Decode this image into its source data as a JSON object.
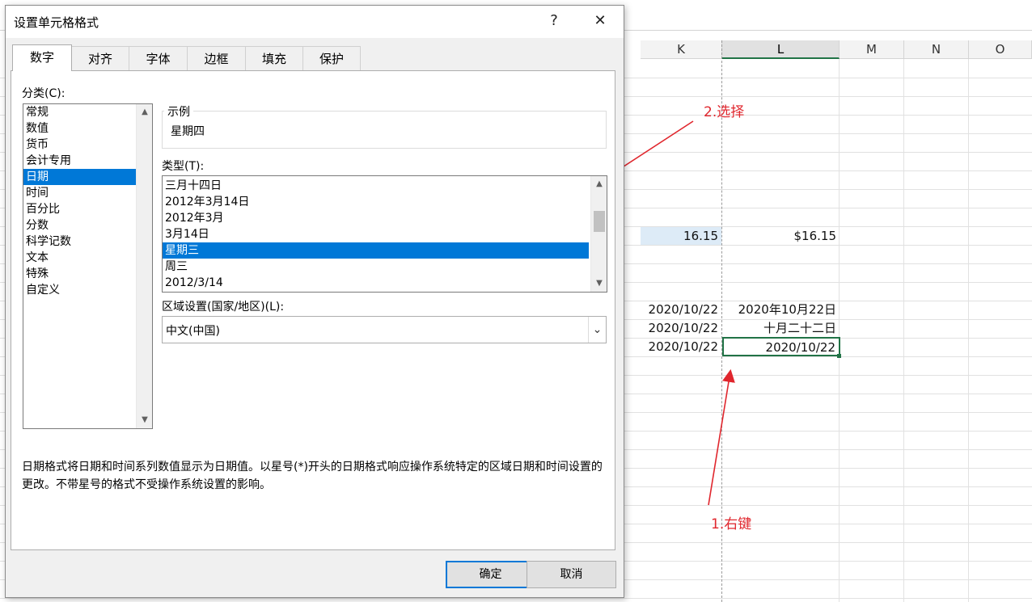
{
  "sheet": {
    "columns": [
      "K",
      "L",
      "M",
      "N",
      "O"
    ],
    "cells": {
      "k_amount": "16.15",
      "l_amount": "$16.15",
      "k_date1": "2020/10/22",
      "l_date1": "2020年10月22日",
      "k_date2": "2020/10/22",
      "l_date2": "十月二十二日",
      "k_date3": "2020/10/22",
      "l_date3": "2020/10/22"
    },
    "selected_fill": "#ddebf7",
    "active_border": "#217346"
  },
  "dialog": {
    "title": "设置单元格格式",
    "help": "?",
    "close": "✕",
    "tabs": [
      {
        "label": "数字"
      },
      {
        "label": "对齐"
      },
      {
        "label": "字体"
      },
      {
        "label": "边框"
      },
      {
        "label": "填充"
      },
      {
        "label": "保护"
      }
    ],
    "category_label": "分类(C):",
    "categories": [
      "常规",
      "数值",
      "货币",
      "会计专用",
      "日期",
      "时间",
      "百分比",
      "分数",
      "科学记数",
      "文本",
      "特殊",
      "自定义"
    ],
    "selected_category": "日期",
    "sample_legend": "示例",
    "sample_value": "星期四",
    "type_label": "类型(T):",
    "types": [
      "三月十四日",
      "2012年3月14日",
      "2012年3月",
      "3月14日",
      "星期三",
      "周三",
      "2012/3/14"
    ],
    "selected_type": "星期三",
    "locale_label": "区域设置(国家/地区)(L):",
    "locale_value": "中文(中国)",
    "description": "日期格式将日期和时间系列数值显示为日期值。以星号(*)开头的日期格式响应操作系统特定的区域日期和时间设置的更改。不带星号的格式不受操作系统设置的影响。",
    "ok": "确定",
    "cancel": "取消",
    "accent": "#0078d7"
  },
  "annotations": {
    "step2": "2.选择",
    "step1": "1.右键",
    "color": "#e0262d"
  }
}
